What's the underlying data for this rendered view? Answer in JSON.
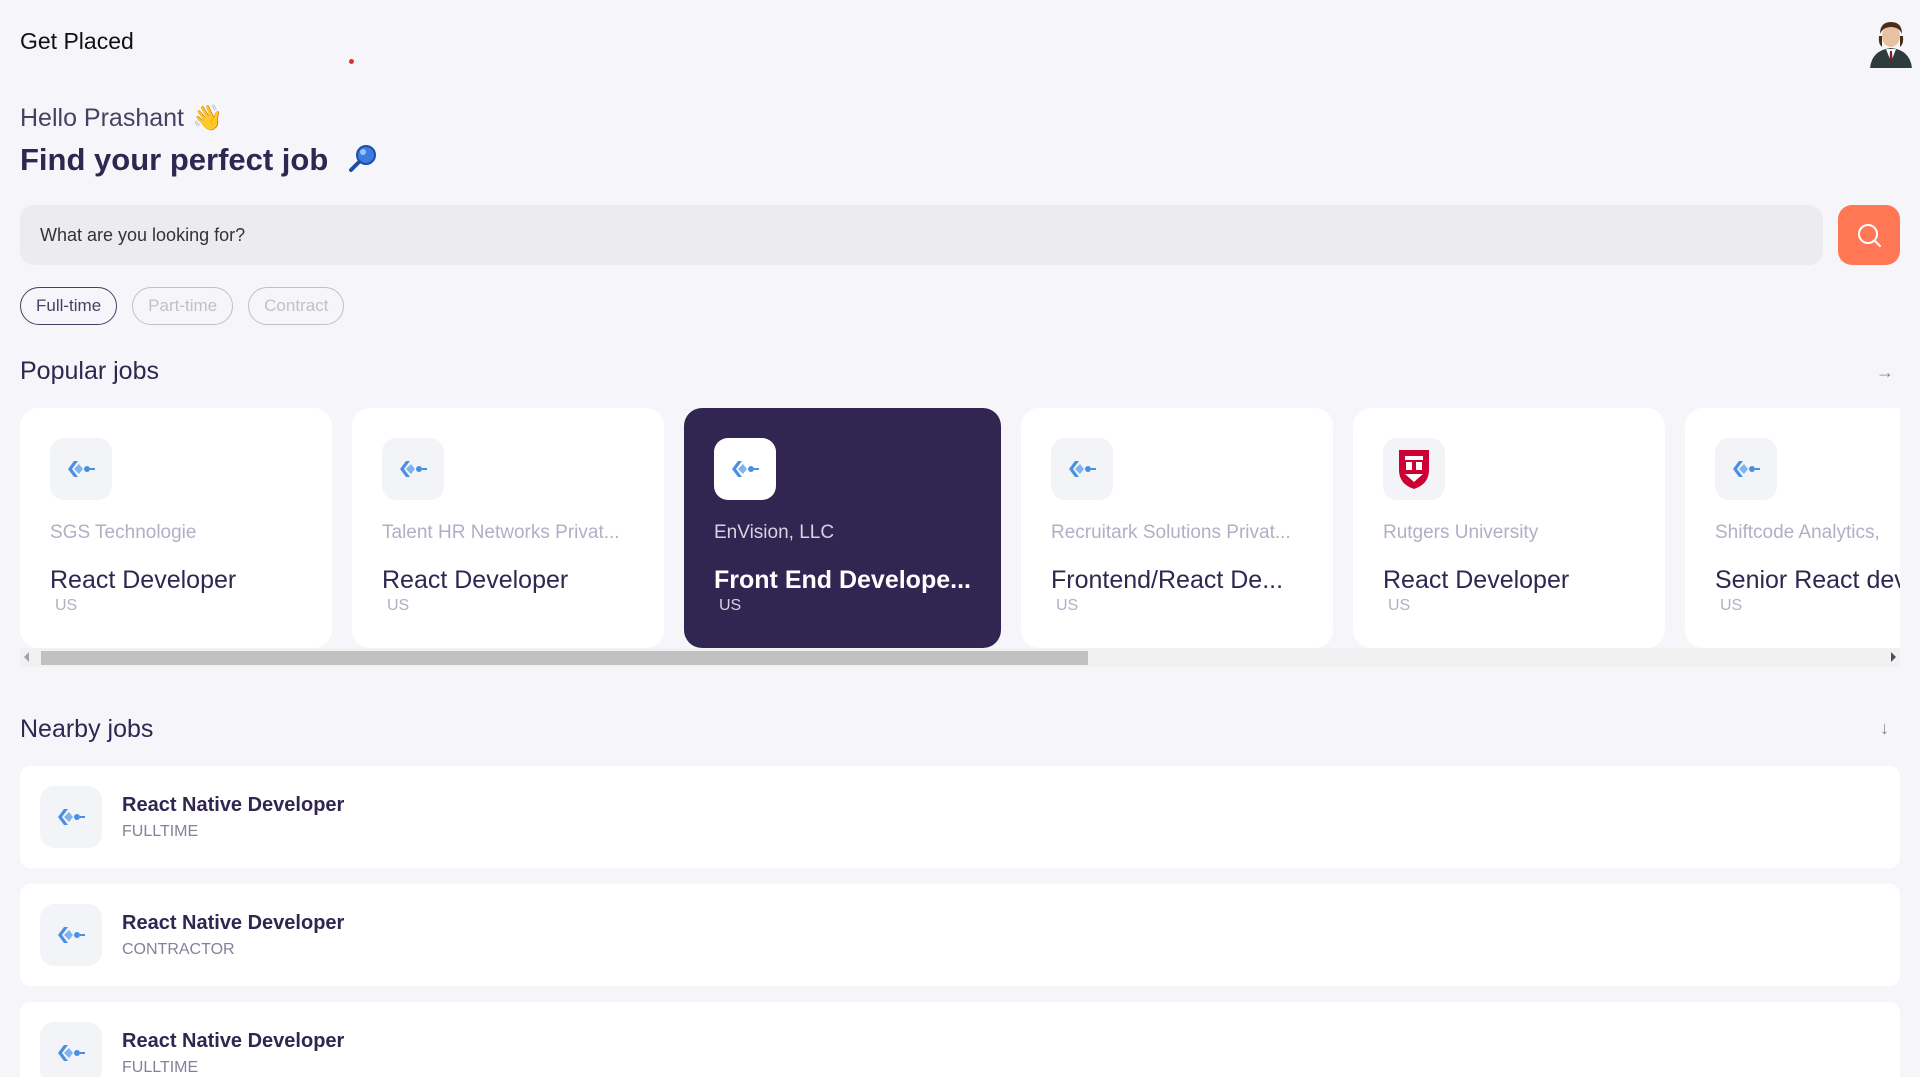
{
  "header": {
    "app_title": "Get Placed"
  },
  "welcome": {
    "greeting": "Hello Prashant",
    "headline": "Find your perfect job"
  },
  "search": {
    "placeholder": "What are you looking for?",
    "value": ""
  },
  "job_types": [
    {
      "label": "Full-time",
      "active": true
    },
    {
      "label": "Part-time",
      "active": false
    },
    {
      "label": "Contract",
      "active": false
    }
  ],
  "popular": {
    "title": "Popular jobs",
    "jobs": [
      {
        "company": "SGS Technologie",
        "title": "React Developer",
        "country": "US",
        "logo": "generic-company-logo"
      },
      {
        "company": "Talent HR Networks Privat...",
        "title": "React Developer",
        "country": "US",
        "logo": "generic-company-logo"
      },
      {
        "company": "EnVision, LLC",
        "title": "Front End Develope...",
        "country": "US",
        "logo": "generic-company-logo",
        "selected": true
      },
      {
        "company": "Recruitark Solutions Privat...",
        "title": "Frontend/React De...",
        "country": "US",
        "logo": "generic-company-logo"
      },
      {
        "company": "Rutgers University",
        "title": "React Developer",
        "country": "US",
        "logo": "rutgers-shield-logo"
      },
      {
        "company": "Shiftcode Analytics,",
        "title": "Senior React dev",
        "country": "US",
        "logo": "generic-company-logo"
      }
    ]
  },
  "nearby": {
    "title": "Nearby jobs",
    "jobs": [
      {
        "title": "React Native Developer",
        "type": "FULLTIME"
      },
      {
        "title": "React Native Developer",
        "type": "CONTRACTOR"
      },
      {
        "title": "React Native Developer",
        "type": "FULLTIME"
      }
    ]
  },
  "colors": {
    "accent": "#ff7754",
    "primary": "#312651",
    "background": "#f6f6fa"
  }
}
